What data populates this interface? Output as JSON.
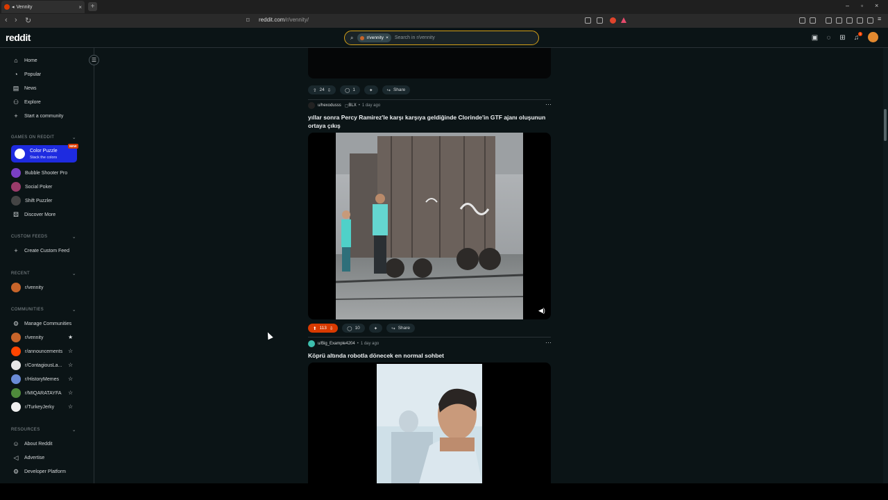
{
  "browser": {
    "tab_title": "Vennity",
    "tab_audio_icon": "speaker-icon",
    "new_tab": "+",
    "url_host": "reddit.com",
    "url_path": "/r/vennity/"
  },
  "header": {
    "logo": "reddit",
    "search_chip": "r/vennity",
    "search_chip_close": "×",
    "search_placeholder": "Search in r/vennity",
    "notification_count": "1"
  },
  "sidebar": {
    "main": [
      {
        "label": "Home",
        "icon": "home-icon"
      },
      {
        "label": "Popular",
        "icon": "popular-icon"
      },
      {
        "label": "News",
        "icon": "news-icon"
      },
      {
        "label": "Explore",
        "icon": "explore-icon"
      },
      {
        "label": "Start a community",
        "icon": "plus-icon"
      }
    ],
    "games_header": "GAMES ON REDDIT",
    "games_featured": {
      "title": "Color Puzzle",
      "subtitle": "Stack the colors",
      "badge": "NEW"
    },
    "games": [
      {
        "label": "Bubble Shooter Pro",
        "color": "#7a3fc4"
      },
      {
        "label": "Social Poker",
        "color": "#9a3b6a"
      },
      {
        "label": "Shift Puzzler",
        "color": "#444"
      },
      {
        "label": "Discover More",
        "icon": "discover-icon"
      }
    ],
    "feeds_header": "CUSTOM FEEDS",
    "feeds": [
      {
        "label": "Create Custom Feed"
      }
    ],
    "recent_header": "RECENT",
    "recent": [
      {
        "label": "r/vennity",
        "color": "#c7642a"
      }
    ],
    "communities_header": "COMMUNITIES",
    "communities_manage": "Manage Communities",
    "communities": [
      {
        "label": "r/vennity",
        "color": "#c7642a",
        "starred": true
      },
      {
        "label": "r/announcements",
        "color": "#ff4500",
        "starred": false
      },
      {
        "label": "r/ContagiousLa...",
        "color": "#e8e8e8",
        "starred": false
      },
      {
        "label": "r/HistoryMemes",
        "color": "#6a8bd6",
        "starred": false
      },
      {
        "label": "r/MIQARATAYFA",
        "color": "#4f8a3b",
        "starred": false
      },
      {
        "label": "r/TurkeyJerky",
        "color": "#f0f0f0",
        "starred": false
      }
    ],
    "resources_header": "RESOURCES",
    "resources": [
      {
        "label": "About Reddit",
        "icon": "reddit-icon"
      },
      {
        "label": "Advertise",
        "icon": "megaphone-icon"
      },
      {
        "label": "Developer Platform",
        "icon": "gear-icon"
      }
    ]
  },
  "feed": {
    "post0": {
      "votes": "24",
      "comments": "1",
      "share": "Share"
    },
    "post1": {
      "author": "u/hexodusss",
      "flair": "BLX",
      "time": "1 day ago",
      "title": "yıllar sonra Percy Ramirez'le karşı karşıya geldiğinde Clorinde'in GTF ajanı oluşunun ortaya çıkış",
      "votes": "113",
      "comments": "10",
      "share": "Share"
    },
    "post2": {
      "author": "u/Big_Example4204",
      "time": "1 day ago",
      "title": "Köprü altında robotla dönecek en normal sohbet"
    }
  }
}
